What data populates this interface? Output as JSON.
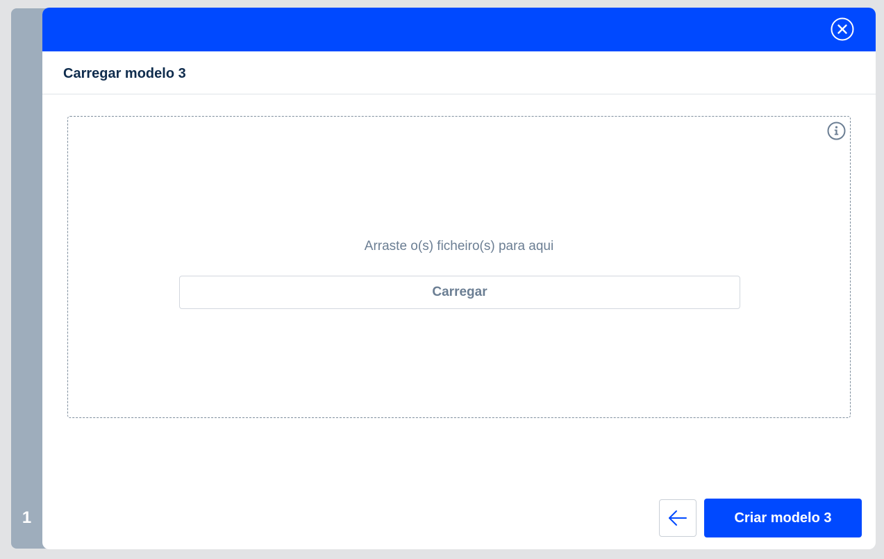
{
  "step": {
    "number": "1"
  },
  "dialog": {
    "title": "Carregar modelo 3",
    "header_color": "#0049ff",
    "close_icon": "close-circle-icon"
  },
  "dropzone": {
    "hint": "Arraste o(s) ficheiro(s) para aqui",
    "upload_label": "Carregar",
    "info_icon": "info-circle-icon"
  },
  "footer": {
    "back_icon": "arrow-left-icon",
    "primary_label": "Criar modelo 3",
    "primary_color": "#0049ff"
  }
}
